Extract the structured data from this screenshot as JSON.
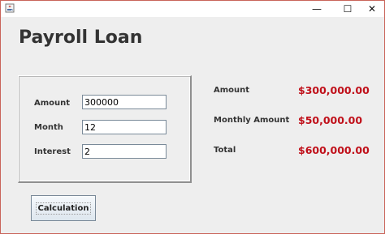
{
  "window": {
    "icons": {
      "app": "java-cup-icon",
      "minimize": "minimize-icon",
      "maximize": "maximize-icon",
      "close": "close-icon"
    },
    "controls": {
      "minimize": "—",
      "maximize": "☐",
      "close": "✕"
    }
  },
  "header": {
    "title": "Payroll Loan"
  },
  "form": {
    "amount": {
      "label": "Amount",
      "value": "300000"
    },
    "month": {
      "label": "Month",
      "value": "12"
    },
    "interest": {
      "label": "Interest",
      "value": "2"
    }
  },
  "results": {
    "amount": {
      "label": "Amount",
      "value": "$300,000.00"
    },
    "monthly": {
      "label": "Monthly Amount",
      "value": "$50,000.00"
    },
    "total": {
      "label": "Total",
      "value": "$600,000.00"
    }
  },
  "actions": {
    "calculate_label": "Calculation"
  },
  "colors": {
    "result_value": "#c0101a",
    "window_border": "#c9645a",
    "background": "#eeeeee"
  }
}
